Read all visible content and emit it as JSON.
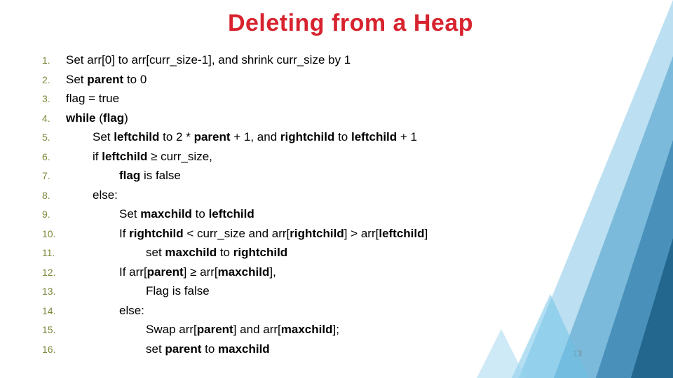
{
  "title": "Deleting from a Heap",
  "page_number": "13",
  "lines": [
    {
      "n": "1.",
      "indent": 0,
      "segments": [
        [
          "",
          "Set arr[0] to arr[curr_size-1], and shrink curr_size by 1"
        ]
      ]
    },
    {
      "n": "2.",
      "indent": 0,
      "segments": [
        [
          "",
          "Set "
        ],
        [
          "b",
          "parent"
        ],
        [
          "",
          " to 0"
        ]
      ]
    },
    {
      "n": "3.",
      "indent": 0,
      "segments": [
        [
          "",
          "flag = true"
        ]
      ]
    },
    {
      "n": "4.",
      "indent": 0,
      "segments": [
        [
          "b",
          "while"
        ],
        [
          "",
          " ("
        ],
        [
          "b",
          "flag"
        ],
        [
          "",
          ")"
        ]
      ]
    },
    {
      "n": "5.",
      "indent": 1,
      "segments": [
        [
          "",
          "Set "
        ],
        [
          "b",
          "leftchild"
        ],
        [
          "",
          " to 2 * "
        ],
        [
          "b",
          "parent"
        ],
        [
          "",
          " + 1, and "
        ],
        [
          "b",
          "rightchild"
        ],
        [
          "",
          " to "
        ],
        [
          "b",
          "leftchild"
        ],
        [
          "",
          " + 1"
        ]
      ]
    },
    {
      "n": "6.",
      "indent": 1,
      "segments": [
        [
          "",
          "if "
        ],
        [
          "b",
          "leftchild"
        ],
        [
          "",
          " ≥ curr_size,"
        ]
      ]
    },
    {
      "n": "7.",
      "indent": 2,
      "segments": [
        [
          "b",
          "flag"
        ],
        [
          "",
          " is false"
        ]
      ]
    },
    {
      "n": "8.",
      "indent": 1,
      "segments": [
        [
          "",
          "else:"
        ]
      ]
    },
    {
      "n": "9.",
      "indent": 2,
      "segments": [
        [
          "",
          "Set "
        ],
        [
          "b",
          "maxchild"
        ],
        [
          "",
          " to "
        ],
        [
          "b",
          "leftchild"
        ]
      ]
    },
    {
      "n": "10.",
      "indent": 2,
      "segments": [
        [
          "",
          "If "
        ],
        [
          "b",
          "rightchild"
        ],
        [
          "",
          " < curr_size and arr["
        ],
        [
          "b",
          "rightchild"
        ],
        [
          "",
          "] > arr["
        ],
        [
          "b",
          "leftchild"
        ],
        [
          "",
          "]"
        ]
      ]
    },
    {
      "n": "11.",
      "indent": 3,
      "segments": [
        [
          "",
          "set "
        ],
        [
          "b",
          "maxchild"
        ],
        [
          "",
          " to "
        ],
        [
          "b",
          "rightchild"
        ]
      ]
    },
    {
      "n": "12.",
      "indent": 2,
      "segments": [
        [
          "",
          "If arr["
        ],
        [
          "b",
          "parent"
        ],
        [
          "",
          "] ≥ arr["
        ],
        [
          "b",
          "maxchild"
        ],
        [
          "",
          "],"
        ]
      ]
    },
    {
      "n": "13.",
      "indent": 3,
      "segments": [
        [
          "",
          "Flag is false"
        ]
      ]
    },
    {
      "n": "14.",
      "indent": 2,
      "segments": [
        [
          "",
          "else:"
        ]
      ]
    },
    {
      "n": "15.",
      "indent": 3,
      "segments": [
        [
          "",
          "Swap arr["
        ],
        [
          "b",
          "parent"
        ],
        [
          "",
          "] and arr["
        ],
        [
          "b",
          "maxchild"
        ],
        [
          "",
          "];"
        ]
      ]
    },
    {
      "n": "16.",
      "indent": 3,
      "segments": [
        [
          "",
          "set "
        ],
        [
          "b",
          "parent"
        ],
        [
          "",
          " to "
        ],
        [
          "b",
          "maxchild"
        ]
      ]
    }
  ]
}
